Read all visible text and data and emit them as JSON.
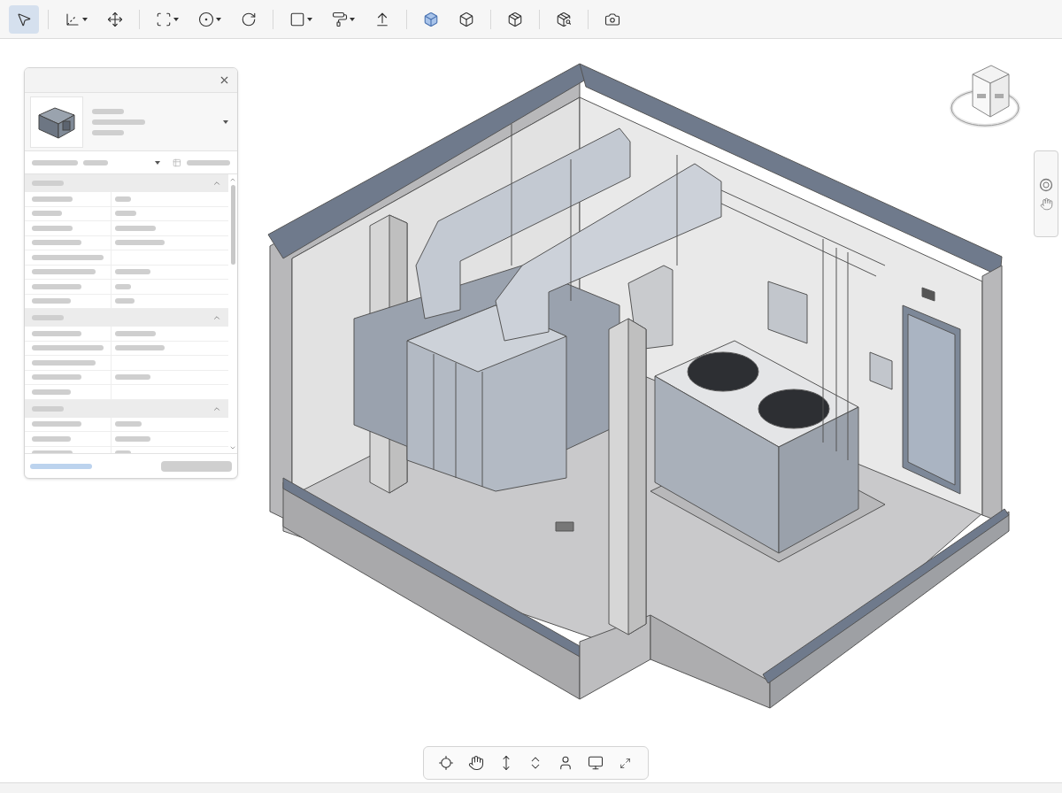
{
  "toolbar": {
    "groups": [
      [
        {
          "kind": "select",
          "selected": true,
          "has_menu": false
        }
      ],
      [
        {
          "kind": "measure",
          "selected": false,
          "has_menu": true
        },
        {
          "kind": "move",
          "selected": false,
          "has_menu": false
        }
      ],
      [
        {
          "kind": "box_select",
          "selected": false,
          "has_menu": true
        },
        {
          "kind": "circle",
          "selected": false,
          "has_menu": true
        },
        {
          "kind": "rotate",
          "selected": false,
          "has_menu": false
        }
      ],
      [
        {
          "kind": "rectangle",
          "selected": false,
          "has_menu": true
        },
        {
          "kind": "paint",
          "selected": false,
          "has_menu": true
        },
        {
          "kind": "elevate",
          "selected": false,
          "has_menu": false
        }
      ],
      [
        {
          "kind": "solid_cube",
          "selected": false,
          "has_menu": false
        },
        {
          "kind": "outline_cube",
          "selected": false,
          "has_menu": false
        }
      ],
      [
        {
          "kind": "section_cube",
          "selected": false,
          "has_menu": false
        }
      ],
      [
        {
          "kind": "info_cube",
          "selected": false,
          "has_menu": false
        }
      ],
      [
        {
          "kind": "camera",
          "selected": false,
          "has_menu": false
        }
      ]
    ]
  },
  "properties_panel": {
    "header": {
      "has_menu": true
    },
    "sections": [
      {
        "expanded": true,
        "rows": [
          {
            "has_value": true
          },
          {
            "has_value": true
          },
          {
            "has_value": true
          },
          {
            "has_value": true
          },
          {
            "has_value": false
          },
          {
            "has_value": true
          },
          {
            "has_value": true
          },
          {
            "has_value": true
          }
        ]
      },
      {
        "expanded": true,
        "rows": [
          {
            "has_value": true
          },
          {
            "has_value": true
          },
          {
            "has_value": false
          },
          {
            "has_value": true
          },
          {
            "has_value": false
          }
        ]
      },
      {
        "expanded": true,
        "rows": [
          {
            "has_value": true
          },
          {
            "has_value": true
          },
          {
            "has_value": true
          }
        ]
      }
    ]
  },
  "navigation_bar": {
    "tools": [
      {
        "kind": "center",
        "selected": false
      },
      {
        "kind": "pan",
        "selected": false
      },
      {
        "kind": "zoom",
        "selected": false
      },
      {
        "kind": "walk",
        "selected": false
      },
      {
        "kind": "look",
        "selected": false
      },
      {
        "kind": "present",
        "selected": false
      },
      {
        "kind": "fit",
        "selected": false
      }
    ]
  }
}
